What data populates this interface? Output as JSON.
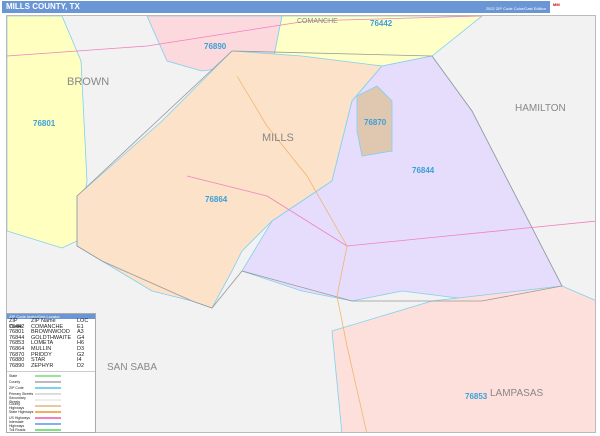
{
  "header": {
    "title": "MILLS COUNTY, TX",
    "edition": "2022 ZIP Code Color/Cast Edition",
    "logo_text": "Marketing MAPS"
  },
  "map": {
    "counties": [
      "BROWN",
      "HAMILTON",
      "MILLS",
      "SAN SABA",
      "LAMPASAS",
      "COMANCHE"
    ],
    "zips": [
      {
        "code": "76442",
        "color": "#ffffc8"
      },
      {
        "code": "76890",
        "color": "#fcd9dc"
      },
      {
        "code": "76801",
        "color": "#ffffc0"
      },
      {
        "code": "76870",
        "color": "#e0c8b0"
      },
      {
        "code": "76844",
        "color": "#e6dcfc"
      },
      {
        "code": "76864",
        "color": "#fce2c8"
      },
      {
        "code": "76853",
        "color": "#fde0dc"
      }
    ]
  },
  "legend": {
    "title": "ZIP Code Index/Grid Locator",
    "headers": [
      "ZIP Code",
      "ZIP Name",
      "LOC"
    ],
    "rows": [
      [
        "76442",
        "COMANCHE",
        "E1"
      ],
      [
        "76801",
        "BROWNWOOD",
        "A3"
      ],
      [
        "76844",
        "GOLDTHWAITE",
        "G4"
      ],
      [
        "76853",
        "LOMETA",
        "H6"
      ],
      [
        "76864",
        "MULLIN",
        "D3"
      ],
      [
        "76870",
        "PRIDDY",
        "G2"
      ],
      [
        "76880",
        "STAR",
        "I4"
      ],
      [
        "76890",
        "ZEPHYR",
        "D2"
      ]
    ],
    "keys": [
      {
        "label": "State",
        "color": "#9be39b"
      },
      {
        "label": "County",
        "color": "#bbbbbb"
      },
      {
        "label": "ZIP Code",
        "color": "#7fd0f0"
      },
      {
        "label": "Primary Streets",
        "color": "#dddddd"
      },
      {
        "label": "Secondary Streets",
        "color": "#eeeeee"
      },
      {
        "label": "County Highways",
        "color": "#e8c8a0"
      },
      {
        "label": "State Highways",
        "color": "#f0b060"
      },
      {
        "label": "US Highways",
        "color": "#f080c0"
      },
      {
        "label": "Interstate Highways",
        "color": "#80b0f0"
      },
      {
        "label": "Toll Roads",
        "color": "#80e080"
      }
    ]
  }
}
